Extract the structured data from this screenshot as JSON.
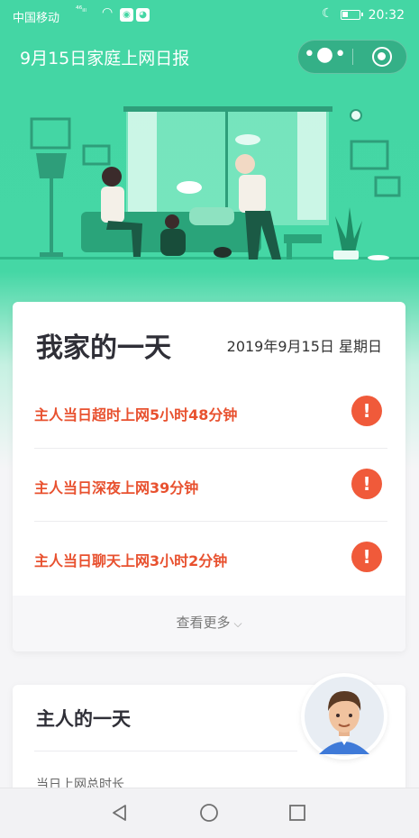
{
  "status_bar": {
    "carrier": "中国移动",
    "signal": "⁴⁶ᵢₗₗ",
    "time": "20:32",
    "battery_level": 0.35
  },
  "nav": {
    "title": "9月15日家庭上网日报",
    "more_icon": "more-dots-icon",
    "close_icon": "record-close-icon"
  },
  "day_card": {
    "title": "我家的一天",
    "date": "2019年9月15日 星期日",
    "alerts": [
      {
        "text": "主人当日超时上网5小时48分钟",
        "icon": "!"
      },
      {
        "text": "主人当日深夜上网39分钟",
        "icon": "!"
      },
      {
        "text": "主人当日聊天上网3小时2分钟",
        "icon": "!"
      }
    ],
    "see_more": "查看更多"
  },
  "owner_card": {
    "title": "主人的一天",
    "subtitle": "当日上网总时长"
  },
  "colors": {
    "brand_green": "#44d6a4",
    "alert_red": "#e8512f",
    "alert_icon": "#f05a3a"
  }
}
